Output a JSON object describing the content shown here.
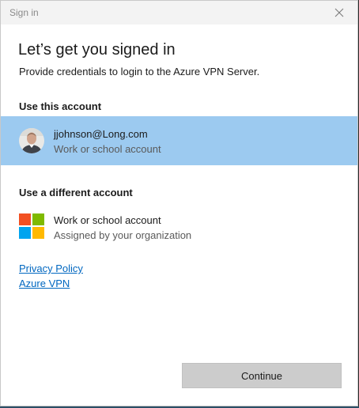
{
  "window": {
    "title": "Sign in"
  },
  "main": {
    "heading": "Let’s get you signed in",
    "subheading": "Provide credentials to login to the Azure VPN Server."
  },
  "current_account_section": {
    "label": "Use this account",
    "account": {
      "email": "jjohnson@Long.com",
      "type": "Work or school account",
      "selected": true
    }
  },
  "other_account_section": {
    "label": "Use a different account",
    "option": {
      "title": "Work or school account",
      "subtitle": "Assigned by your organization",
      "icon": "microsoft-logo-icon"
    }
  },
  "links": {
    "privacy": "Privacy Policy",
    "azure_vpn": "Azure VPN"
  },
  "actions": {
    "continue_label": "Continue"
  },
  "colors": {
    "selected_row": "#9ccaf0",
    "link": "#0067c0",
    "button_bg": "#cccccc",
    "ms_red": "#f25022",
    "ms_green": "#7fba00",
    "ms_blue": "#00a4ef",
    "ms_yellow": "#ffb900"
  }
}
